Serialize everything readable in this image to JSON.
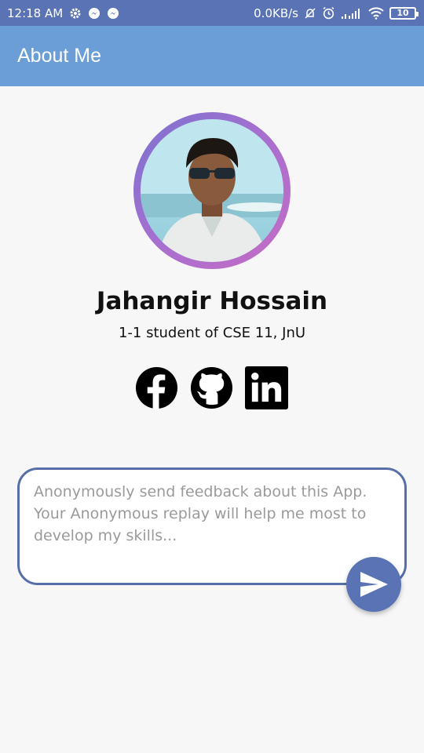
{
  "status_bar": {
    "time": "12:18 AM",
    "network_speed": "0.0KB/s",
    "battery": "10",
    "icons": [
      "gear-icon",
      "messenger-icon",
      "messenger-icon",
      "mute-icon",
      "alarm-icon",
      "signal-icon",
      "wifi-icon",
      "battery-icon"
    ]
  },
  "app_bar": {
    "title": "About Me"
  },
  "profile": {
    "name": "Jahangir Hossain",
    "subtitle": "1-1 student of CSE 11, JnU"
  },
  "social": [
    {
      "name": "facebook-icon"
    },
    {
      "name": "github-icon"
    },
    {
      "name": "linkedin-icon"
    }
  ],
  "feedback": {
    "placeholder": "Anonymously send feedback about this App. Your Anonymous replay will help me most to develop my skills...",
    "value": ""
  },
  "colors": {
    "status_bar": "#5a73b4",
    "app_bar": "#6b9ed6",
    "accent": "#566fa8"
  }
}
